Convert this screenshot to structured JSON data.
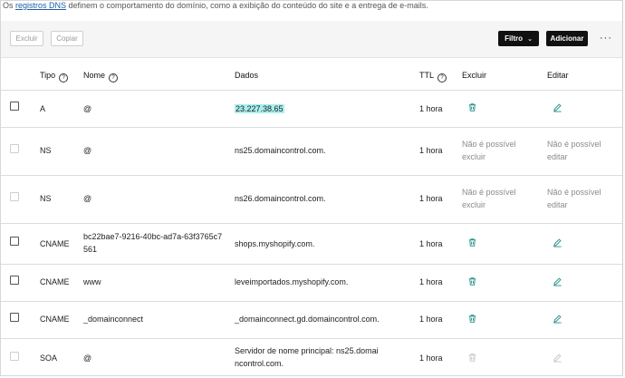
{
  "intro": {
    "prefix": "Os ",
    "link": "registros DNS",
    "suffix": " definem o comportamento do domínio, como a exibição do conteúdo do site e a entrega de e-mails."
  },
  "toolbar": {
    "delete_label": "Excluir",
    "copy_label": "Copiar",
    "filter_label": "Filtro",
    "add_label": "Adicionar",
    "more_label": "···"
  },
  "columns": {
    "type": "Tipo",
    "name": "Nome",
    "data": "Dados",
    "ttl": "TTL",
    "delete": "Excluir",
    "edit": "Editar"
  },
  "records": [
    {
      "type": "A",
      "name": "@",
      "data": "23.227.38.65",
      "ttl": "1 hora",
      "delete": "",
      "edit": ""
    },
    {
      "type": "NS",
      "name": "@",
      "data": "ns25.domaincontrol.com.",
      "ttl": "1 hora",
      "delete": "Não é possível excluir",
      "edit": "Não é possível editar"
    },
    {
      "type": "NS",
      "name": "@",
      "data": "ns26.domaincontrol.com.",
      "ttl": "1 hora",
      "delete": "Não é possível excluir",
      "edit": "Não é possível editar"
    },
    {
      "type": "CNAME",
      "name": "bc22bae7-9216-40bc-ad7a-63f3765c7561",
      "data": "shops.myshopify.com.",
      "ttl": "1 hora",
      "delete": "",
      "edit": ""
    },
    {
      "type": "CNAME",
      "name": "www",
      "data": "leveimportados.myshopify.com.",
      "ttl": "1 hora",
      "delete": "",
      "edit": ""
    },
    {
      "type": "CNAME",
      "name": "_domainconnect",
      "data": "_domainconnect.gd.domaincontrol.com.",
      "ttl": "1 hora",
      "delete": "",
      "edit": ""
    },
    {
      "type": "SOA",
      "name": "@",
      "data": "Servidor de nome principal: ns25.domaincontrol.com.",
      "ttl": "1 hora",
      "delete": "",
      "edit": ""
    }
  ],
  "icons": {
    "delete": "trash-icon",
    "edit": "pencil-icon",
    "help": "question-circle-icon"
  },
  "colors": {
    "accent_teal": "#1f8f86",
    "highlight": "#a8efef",
    "dark_button": "#111111"
  }
}
